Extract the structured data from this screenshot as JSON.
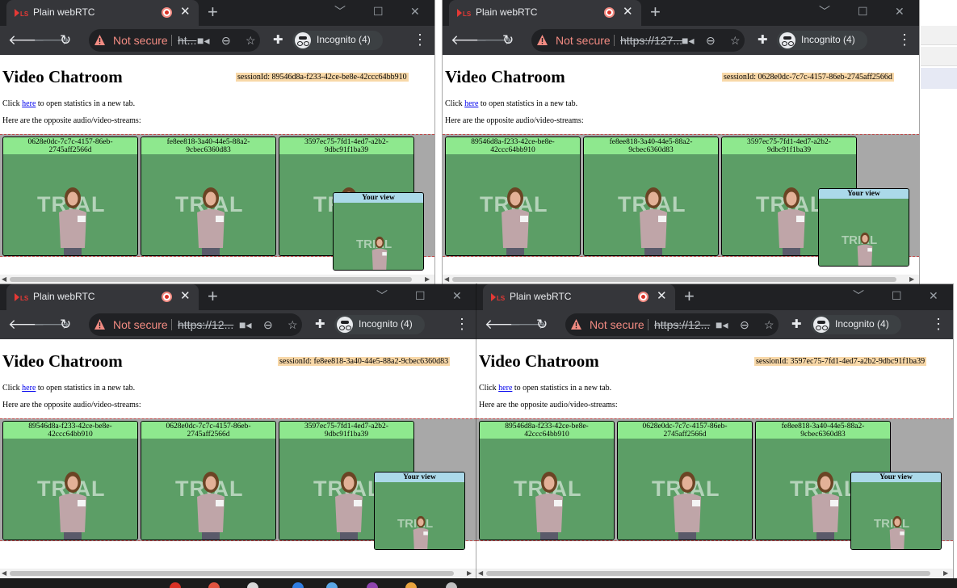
{
  "windows": [
    {
      "tab_title": "Plain webRTC",
      "omnibox": {
        "security": "Not secure",
        "url": "ht..."
      },
      "profile": "Incognito (4)",
      "page": {
        "heading": "Video Chatroom",
        "session": "sessionId: 89546d8a-f233-42ce-be8e-42ccc64bb910",
        "click_prefix": "Click ",
        "link_text": "here",
        "click_suffix": " to open statistics in a new tab.",
        "streams_intro": "Here are the opposite audio/video-streams:",
        "tiles": [
          {
            "line1": "0628e0dc-7c7c-4157-86eb-",
            "line2": "2745aff2566d"
          },
          {
            "line1": "fe8ee818-3a40-44e5-88a2-",
            "line2": "9cbec6360d83"
          },
          {
            "line1": "3597ec75-7fd1-4ed7-a2b2-",
            "line2": "9dbc91f1ba39"
          }
        ],
        "watermark": "TRIAL",
        "own_view": {
          "label": "Your view",
          "watermark": "TRIAL"
        }
      }
    },
    {
      "tab_title": "Plain webRTC",
      "omnibox": {
        "security": "Not secure",
        "url": "https://127..."
      },
      "profile": "Incognito (4)",
      "page": {
        "heading": "Video Chatroom",
        "session": "sessionId: 0628e0dc-7c7c-4157-86eb-2745aff2566d",
        "click_prefix": "Click ",
        "link_text": "here",
        "click_suffix": " to open statistics in a new tab.",
        "streams_intro": "Here are the opposite audio/video-streams:",
        "tiles": [
          {
            "line1": "89546d8a-f233-42ce-be8e-",
            "line2": "42ccc64bb910"
          },
          {
            "line1": "fe8ee818-3a40-44e5-88a2-",
            "line2": "9cbec6360d83"
          },
          {
            "line1": "3597ec75-7fd1-4ed7-a2b2-",
            "line2": "9dbc91f1ba39"
          }
        ],
        "watermark": "TRIAL",
        "own_view": {
          "label": "Your view",
          "watermark": "TRIAL"
        }
      }
    },
    {
      "tab_title": "Plain webRTC",
      "omnibox": {
        "security": "Not secure",
        "url": "https://12..."
      },
      "profile": "Incognito (4)",
      "page": {
        "heading": "Video Chatroom",
        "session": "sessionId: fe8ee818-3a40-44e5-88a2-9cbec6360d83",
        "click_prefix": "Click ",
        "link_text": "here",
        "click_suffix": " to open statistics in a new tab.",
        "streams_intro": "Here are the opposite audio/video-streams:",
        "tiles": [
          {
            "line1": "89546d8a-f233-42ce-be8e-",
            "line2": "42ccc64bb910"
          },
          {
            "line1": "0628e0dc-7c7c-4157-86eb-",
            "line2": "2745aff2566d"
          },
          {
            "line1": "3597ec75-7fd1-4ed7-a2b2-",
            "line2": "9dbc91f1ba39"
          }
        ],
        "watermark": "TRIAL",
        "own_view": {
          "label": "Your view",
          "watermark": "TRIAL"
        }
      }
    },
    {
      "tab_title": "Plain webRTC",
      "omnibox": {
        "security": "Not secure",
        "url": "https://12..."
      },
      "profile": "Incognito (4)",
      "page": {
        "heading": "Video Chatroom",
        "session": "sessionId: 3597ec75-7fd1-4ed7-a2b2-9dbc91f1ba39",
        "click_prefix": "Click ",
        "link_text": "here",
        "click_suffix": " to open statistics in a new tab.",
        "streams_intro": "Here are the opposite audio/video-streams:",
        "tiles": [
          {
            "line1": "89546d8a-f233-42ce-be8e-",
            "line2": "42ccc64bb910"
          },
          {
            "line1": "0628e0dc-7c7c-4157-86eb-",
            "line2": "2745aff2566d"
          },
          {
            "line1": "fe8ee818-3a40-44e5-88a2-",
            "line2": "9cbec6360d83"
          }
        ],
        "watermark": "TRIAL",
        "own_view": {
          "label": "Your view",
          "watermark": "TRIAL"
        }
      }
    }
  ],
  "colors": {
    "titlebar": "#202124",
    "toolbar": "#35363a",
    "not_secure": "#f28b82",
    "session_badge": "#f8d8a8",
    "tile_header": "#8ee88e",
    "own_view_header": "#abd9e9",
    "video_background": "#5b9f65",
    "streams_background": "#a8a8a8"
  },
  "icons": {
    "tab": [
      "app-logo-icon",
      "recording-icon",
      "close-icon",
      "new-tab-icon"
    ],
    "window": [
      "minimize-icon",
      "maximize-icon",
      "close-window-icon"
    ],
    "toolbar": [
      "back-arrow-icon",
      "forward-arrow-icon",
      "reload-icon",
      "warning-icon",
      "camera-icon",
      "zoom-icon",
      "star-icon",
      "extensions-icon",
      "incognito-icon",
      "more-menu-icon"
    ]
  }
}
